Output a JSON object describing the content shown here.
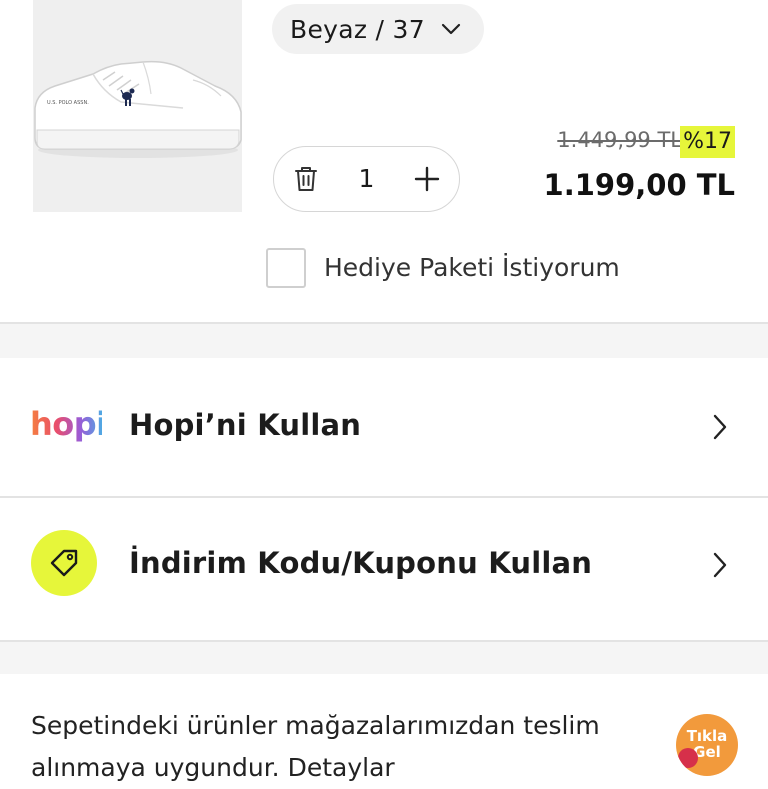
{
  "product": {
    "variant_label": "Beyaz / 37",
    "old_price": "1.449,99 TL",
    "discount": "%17",
    "price": "1.199,00 TL",
    "quantity": "1",
    "gift_label": "Hediye Paketi İstiyorum",
    "image_brand_text": "U.S. POLO ASSN."
  },
  "actions": {
    "hopi": {
      "logo": "hopi",
      "label": "Hopi’ni Kullan"
    },
    "coupon": {
      "label": "İndirim Kodu/Kuponu Kullan"
    }
  },
  "delivery": {
    "line1": "Sepetindeki ürünler mağazalarımızdan teslim",
    "line2": "alınmaya uygundur. Detaylar",
    "badge_line1": "Tıkla",
    "badge_line2": "Gel"
  },
  "colors": {
    "accent_yellow": "#e6f63a",
    "badge_orange": "#f29a3c",
    "hopi_gradient": [
      "#f5803e",
      "#e94e6c",
      "#9b5bd6",
      "#3fb9e6"
    ]
  }
}
